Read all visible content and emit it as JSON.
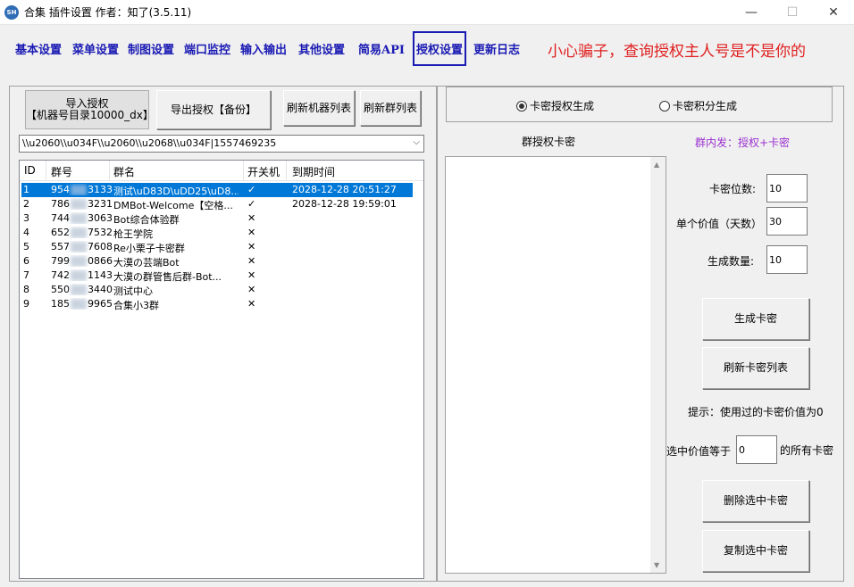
{
  "window": {
    "icon_text": "SH",
    "title": "合集 插件设置  作者：知了(3.5.11)",
    "minimize": "—",
    "maximize": "☐",
    "close": "✕"
  },
  "menu": {
    "items": [
      "基本设置",
      "菜单设置",
      "制图设置",
      "端口监控",
      "输入输出",
      "其他设置",
      "简易API",
      "授权设置",
      "更新日志"
    ],
    "active_index": 7,
    "warning": "小心骗子，查询授权主人号是不是你的"
  },
  "left": {
    "buttons": {
      "import_line1": "导入授权",
      "import_line2": "【机器号目录10000_dx】",
      "export": "导出授权【备份】",
      "refresh_machines": "刷新机器列表",
      "refresh_groups": "刷新群列表"
    },
    "combo_value": "\\\\u2060\\\\u034F\\\\u2060\\\\u2068\\\\u034F|1557469235",
    "combo_arrow": "⌵",
    "table": {
      "columns": [
        "ID",
        "群号",
        "群名",
        "开关机",
        "到期时间"
      ],
      "rows": [
        {
          "id": "1",
          "qq_a": "954",
          "qq_b": "3133",
          "name": "测试\\uD83D\\uDD25\\uD8...",
          "status": "✓",
          "expire": "2028-12-28 20:51:27",
          "selected": true
        },
        {
          "id": "2",
          "qq_a": "786",
          "qq_b": "3231",
          "name": "DMBot-Welcome【空格...",
          "status": "✓",
          "expire": "2028-12-28 19:59:01",
          "selected": false
        },
        {
          "id": "3",
          "qq_a": "744",
          "qq_b": "3063",
          "name": "Bot综合体验群",
          "status": "✕",
          "expire": "",
          "selected": false
        },
        {
          "id": "4",
          "qq_a": "652",
          "qq_b": "7532",
          "name": "枪王学院",
          "status": "✕",
          "expire": "",
          "selected": false
        },
        {
          "id": "5",
          "qq_a": "557",
          "qq_b": "7608",
          "name": "Re小栗子卡密群",
          "status": "✕",
          "expire": "",
          "selected": false
        },
        {
          "id": "6",
          "qq_a": "799",
          "qq_b": "0866",
          "name": "大漠の芸端Bot",
          "status": "✕",
          "expire": "",
          "selected": false
        },
        {
          "id": "7",
          "qq_a": "742",
          "qq_b": "1143",
          "name": "大漠の群管售后群-Bot...",
          "status": "✕",
          "expire": "",
          "selected": false
        },
        {
          "id": "8",
          "qq_a": "550",
          "qq_b": "3440",
          "name": "测试中心",
          "status": "✕",
          "expire": "",
          "selected": false
        },
        {
          "id": "9",
          "qq_a": "185",
          "qq_b": "9965",
          "name": "合集小3群",
          "status": "✕",
          "expire": "",
          "selected": false
        }
      ]
    }
  },
  "right": {
    "radio_1": "卡密授权生成",
    "radio_2": "卡密积分生成",
    "selected_radio": 1,
    "textarea_label": "群授权卡密",
    "hint_purple": "群内发：授权+卡密",
    "purple_color": "#9b30d0",
    "fields": {
      "digits_label": "卡密位数:",
      "digits_value": "10",
      "value_label": "单个价值（天数）",
      "value_value": "30",
      "count_label": "生成数量:",
      "count_value": "10"
    },
    "generate_button": "生成卡密",
    "refresh_button": "刷新卡密列表",
    "tip": "提示：使用过的卡密价值为0",
    "select_prefix": "选中价值等于",
    "select_value": "0",
    "select_suffix": "的所有卡密",
    "delete_button": "删除选中卡密",
    "copy_button": "复制选中卡密"
  }
}
